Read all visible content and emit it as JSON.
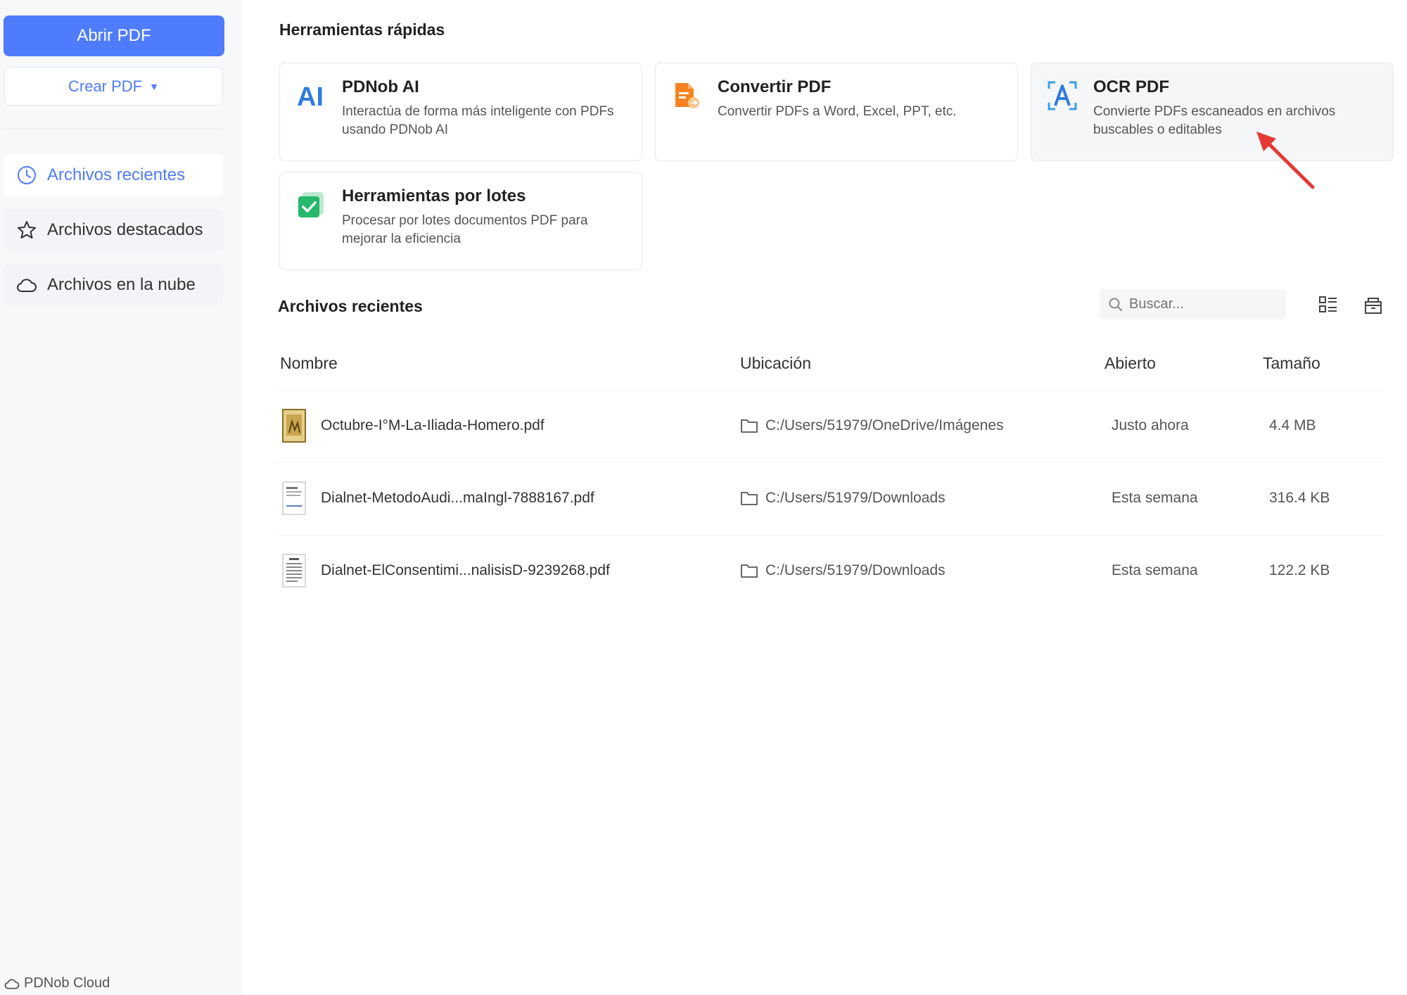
{
  "sidebar": {
    "open_button": "Abrir PDF",
    "create_button": "Crear PDF",
    "items": [
      {
        "label": "Archivos recientes",
        "icon": "clock-icon",
        "active": true
      },
      {
        "label": "Archivos destacados",
        "icon": "star-icon",
        "active": false
      },
      {
        "label": "Archivos en la nube",
        "icon": "cloud-icon",
        "active": false
      }
    ],
    "footer": "PDNob Cloud"
  },
  "quick_tools": {
    "title": "Herramientas rápidas",
    "cards": [
      {
        "title": "PDNob AI",
        "desc": "Interactúa de forma más inteligente con PDFs usando PDNob AI",
        "icon": "ai-icon"
      },
      {
        "title": "Convertir PDF",
        "desc": "Convertir PDFs a Word, Excel, PPT, etc.",
        "icon": "convert-icon"
      },
      {
        "title": "OCR PDF",
        "desc": "Convierte PDFs escaneados en archivos buscables o editables",
        "icon": "ocr-icon"
      },
      {
        "title": "Herramientas por lotes",
        "desc": "Procesar por lotes documentos PDF para mejorar la eficiencia",
        "icon": "batch-icon"
      }
    ]
  },
  "recent": {
    "title": "Archivos recientes",
    "search_placeholder": "Buscar...",
    "columns": [
      "Nombre",
      "Ubicación",
      "Abierto",
      "Tamaño"
    ],
    "files": [
      {
        "name": "Octubre-I°M-La-Iliada-Homero.pdf",
        "location": "C:/Users/51979/OneDrive/Imágenes",
        "opened": "Justo ahora",
        "size": "4.4 MB"
      },
      {
        "name": "Dialnet-MetodoAudi...maIngl-7888167.pdf",
        "location": "C:/Users/51979/Downloads",
        "opened": "Esta semana",
        "size": "316.4 KB"
      },
      {
        "name": "Dialnet-ElConsentimi...nalisisD-9239268.pdf",
        "location": "C:/Users/51979/Downloads",
        "opened": "Esta semana",
        "size": "122.2 KB"
      }
    ]
  },
  "colors": {
    "accent": "#4f7cff",
    "sidebar_bg": "#f7f8fa",
    "annotation_arrow": "#e53935"
  }
}
